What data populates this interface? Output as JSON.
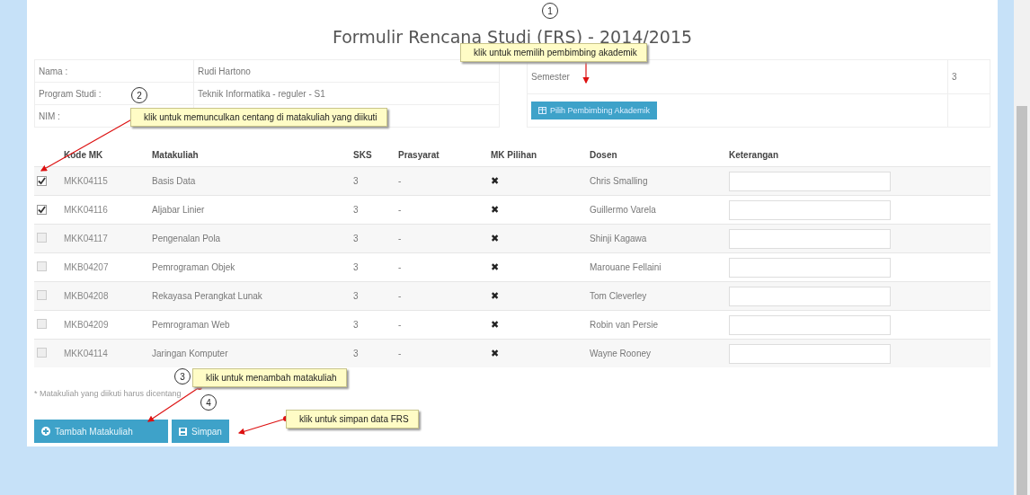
{
  "title": "Formulir Rencana Studi (FRS) - 2014/2015",
  "student": [
    {
      "label": "Nama :",
      "value": "Rudi Hartono"
    },
    {
      "label": "Program Studi :",
      "value": "Teknik Informatika - reguler - S1"
    },
    {
      "label": "NIM :"
    }
  ],
  "semester": {
    "label": "Semester",
    "value": "3"
  },
  "advisor_button": "Pilih Pembimbing Akademik",
  "table": {
    "columns": [
      "Kode MK",
      "Matakuliah",
      "SKS",
      "Prasyarat",
      "MK Pilihan",
      "Dosen",
      "Keterangan"
    ],
    "rows": [
      {
        "checked": true,
        "kode": "MKK04115",
        "matakuliah": "Basis Data",
        "sks": "3",
        "prasyarat": "-",
        "mk_pilihan": "✖",
        "dosen": "Chris Smalling"
      },
      {
        "checked": true,
        "kode": "MKK04116",
        "matakuliah": "Aljabar Linier",
        "sks": "3",
        "prasyarat": "-",
        "mk_pilihan": "✖",
        "dosen": "Guillermo Varela"
      },
      {
        "checked": false,
        "kode": "MKK04117",
        "matakuliah": "Pengenalan Pola",
        "sks": "3",
        "prasyarat": "-",
        "mk_pilihan": "✖",
        "dosen": "Shinji Kagawa"
      },
      {
        "checked": false,
        "kode": "MKB04207",
        "matakuliah": "Pemrograman Objek",
        "sks": "3",
        "prasyarat": "-",
        "mk_pilihan": "✖",
        "dosen": "Marouane Fellaini"
      },
      {
        "checked": false,
        "kode": "MKB04208",
        "matakuliah": "Rekayasa Perangkat Lunak",
        "sks": "3",
        "prasyarat": "-",
        "mk_pilihan": "✖",
        "dosen": "Tom Cleverley"
      },
      {
        "checked": false,
        "kode": "MKB04209",
        "matakuliah": "Pemrograman Web",
        "sks": "3",
        "prasyarat": "-",
        "mk_pilihan": "✖",
        "dosen": "Robin van Persie"
      },
      {
        "checked": false,
        "kode": "MKK04114",
        "matakuliah": "Jaringan Komputer",
        "sks": "3",
        "prasyarat": "-",
        "mk_pilihan": "✖",
        "dosen": "Wayne Rooney"
      }
    ]
  },
  "note": "* Matakuliah yang diikuti harus dicentang",
  "buttons": [
    {
      "kind": "add",
      "label": "Tambah Matakuliah"
    },
    {
      "kind": "save",
      "label": "Simpan"
    }
  ],
  "annotations": [
    {
      "number": "1",
      "text": "klik untuk memilih pembimbing akademik"
    },
    {
      "number": "2",
      "text": "klik untuk memunculkan centang di matakuliah yang diikuti"
    },
    {
      "number": "3",
      "text": "klik untuk menambah matakuliah"
    },
    {
      "number": "4",
      "text": "klik untuk simpan data FRS"
    }
  ]
}
